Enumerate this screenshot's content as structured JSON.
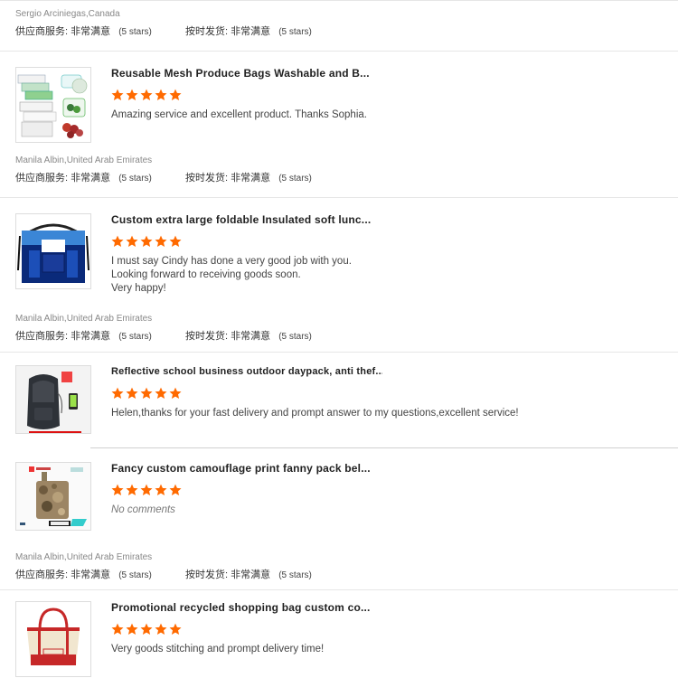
{
  "star_color": "#ff6a00",
  "rating_labels": {
    "supplier_service": "供应商服务:",
    "on_time_delivery": "按时发货:",
    "very_satisfied": "非常满意",
    "five_stars": "(5 stars)"
  },
  "meta_blocks": [
    {
      "buyer": "Sergio Arciniegas,Canada"
    },
    {
      "buyer": "Manila Albin,United Arab Emirates"
    },
    {
      "buyer": "Manila Albin,United Arab Emirates"
    },
    {
      "buyer": "Manila Albin,United Arab Emirates"
    }
  ],
  "reviews": [
    {
      "title": "Reusable Mesh Produce Bags Washable and B...",
      "stars": 5,
      "comment": "Amazing service and excellent product. Thanks Sophia.",
      "thumb_icon": "mesh-produce-bags-icon"
    },
    {
      "title": "Custom extra large foldable Insulated soft lunc...",
      "stars": 5,
      "comment_lines": [
        "I must say Cindy has done a very good job with you.",
        "Looking forward to receiving goods soon.",
        "Very happy!"
      ],
      "thumb_icon": "cooler-bag-icon"
    },
    {
      "title": "Reflective school business outdoor daypack, anti thef...",
      "stars": 5,
      "comment": "Helen,thanks for your fast delivery and prompt answer to my questions,excellent service!",
      "thumb_icon": "backpack-icon"
    },
    {
      "title": "Fancy custom camouflage print fanny pack bel...",
      "stars": 5,
      "comment": "No comments",
      "thumb_icon": "camouflage-fanny-pack-icon"
    },
    {
      "title": "Promotional recycled shopping bag custom co...",
      "stars": 5,
      "comment": "Very goods stitching and prompt delivery time!",
      "thumb_icon": "canvas-tote-bag-icon"
    }
  ]
}
